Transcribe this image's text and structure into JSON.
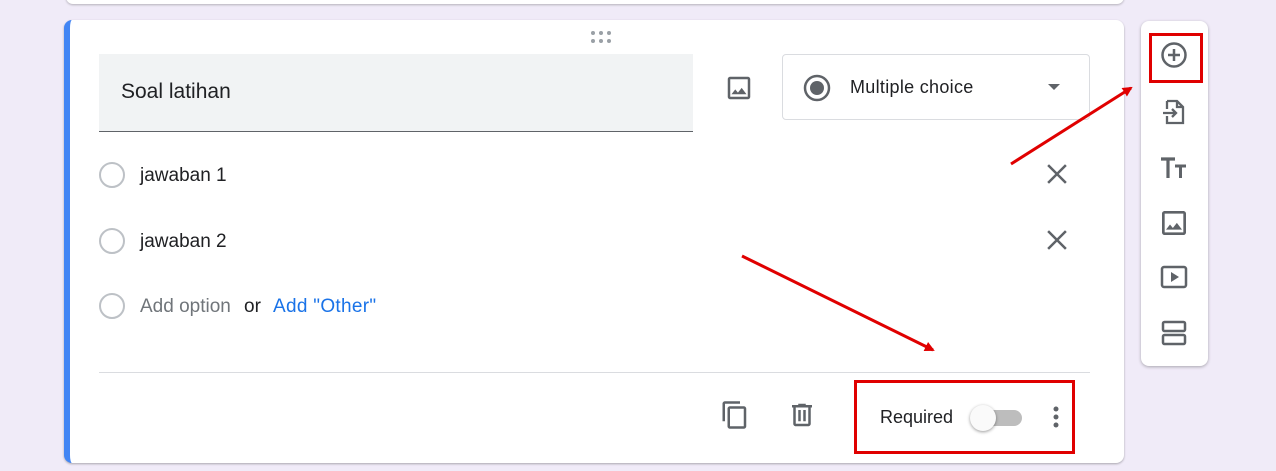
{
  "question": {
    "title": "Soal latihan",
    "type_select": {
      "selected": "Multiple choice"
    },
    "options": [
      {
        "label": "jawaban 1"
      },
      {
        "label": "jawaban 2"
      }
    ],
    "add_option_label": "Add option",
    "or_label": "or",
    "add_other_label": "Add \"Other\"",
    "footer": {
      "required_label": "Required",
      "required_on": false
    }
  },
  "side_toolbar": {
    "tools": [
      "add-question-icon",
      "import-questions-icon",
      "add-title-icon",
      "add-image-icon",
      "add-video-icon",
      "add-section-icon"
    ]
  },
  "annotations": {
    "color": "#e00000"
  },
  "colors": {
    "accent": "#4285f4",
    "link": "#1a73e8",
    "background": "#f0ebf8"
  }
}
